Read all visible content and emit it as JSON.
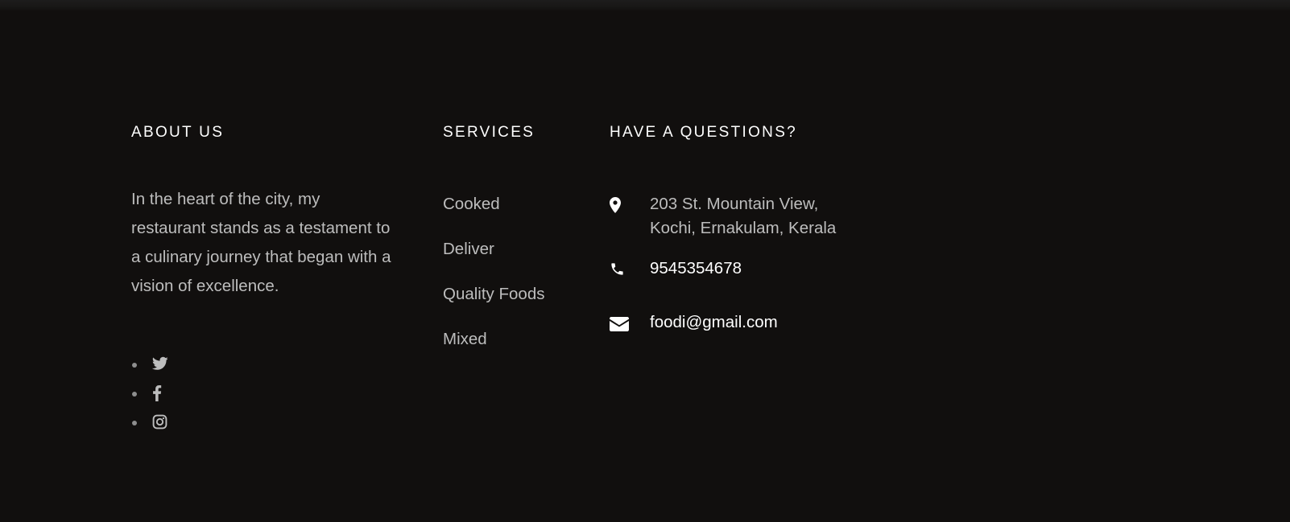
{
  "about": {
    "heading": "ABOUT US",
    "text": "In the heart of the city, my restaurant stands as a testament to a culinary journey that began with a vision of excellence.",
    "social": [
      {
        "icon": "twitter-icon"
      },
      {
        "icon": "facebook-icon"
      },
      {
        "icon": "instagram-icon"
      }
    ]
  },
  "services": {
    "heading": "SERVICES",
    "items": [
      "Cooked",
      "Deliver",
      "Quality Foods",
      "Mixed"
    ]
  },
  "contact": {
    "heading": "HAVE A QUESTIONS?",
    "address_line1": "203 St. Mountain View,",
    "address_line2": "Kochi, Ernakulam, Kerala",
    "phone": "9545354678",
    "email": "foodi@gmail.com"
  },
  "colors": {
    "background": "#110f0e",
    "heading": "#ffffff",
    "body_text": "#bdbdbd",
    "accent_text": "#ffffff"
  }
}
